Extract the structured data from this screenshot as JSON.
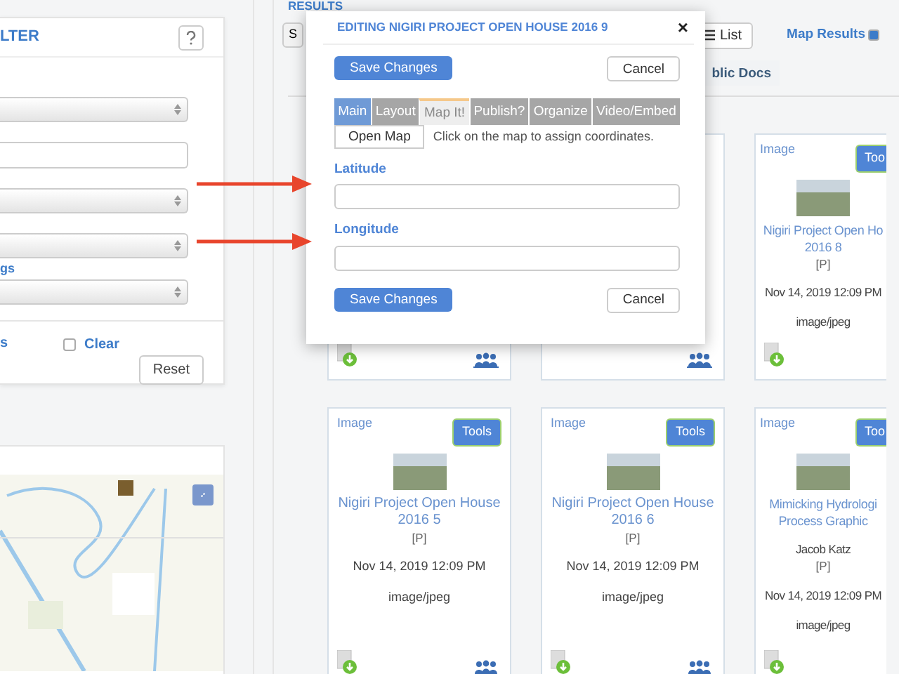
{
  "filter_panel": {
    "title": "LTER",
    "fields": [
      {
        "kind": "select"
      },
      {
        "kind": "input"
      },
      {
        "kind": "select"
      },
      {
        "kind": "select"
      },
      {
        "kind": "label",
        "text": "gs"
      },
      {
        "kind": "select"
      }
    ],
    "link": "s",
    "clear": {
      "label": "Clear",
      "checked": false
    },
    "reset_button": "Reset"
  },
  "results": {
    "heading": "RESULTS",
    "search_button": "S",
    "list_button": "List",
    "map_results": {
      "label": "Map Results",
      "checked": true
    },
    "tab": "blic Docs",
    "rows": [
      [
        {
          "kind": "covered",
          "download": true,
          "shared": true
        },
        {
          "kind": "covered",
          "download": false,
          "shared": true
        },
        {
          "kind": "full",
          "type": "Image",
          "tools": "Too",
          "title": "Nigiri Project Open Ho",
          "title_2": "2016 8",
          "tag": "[P]",
          "date": "Nov 14, 2019 12:09 PM",
          "mime": "image/jpeg",
          "download": true,
          "shared": false
        }
      ],
      [
        {
          "kind": "full",
          "type": "Image",
          "tools": "Tools",
          "title": "Nigiri Project Open House",
          "title_2": "2016 5",
          "tag": "[P]",
          "date": "Nov 14, 2019 12:09 PM",
          "mime": "image/jpeg",
          "download": true,
          "shared": true
        },
        {
          "kind": "full",
          "type": "Image",
          "tools": "Tools",
          "title": "Nigiri Project Open House",
          "title_2": "2016 6",
          "tag": "[P]",
          "date": "Nov 14, 2019 12:09 PM",
          "mime": "image/jpeg",
          "download": true,
          "shared": true
        },
        {
          "kind": "full",
          "type": "Image",
          "tools": "Too",
          "title": "Mimicking Hydrologi",
          "title_2": "Process Graphic",
          "author": "Jacob Katz",
          "tag": "[P]",
          "date": "Nov 14, 2019 12:09 PM",
          "mime": "image/jpeg",
          "download": true,
          "shared": false
        }
      ]
    ]
  },
  "modal": {
    "title": "EDITING NIGIRI PROJECT OPEN HOUSE 2016 9",
    "close": "×",
    "save_button": "Save Changes",
    "cancel_button": "Cancel",
    "tabs": [
      {
        "label": "Main",
        "selected": false
      },
      {
        "label": "Layout",
        "selected": false
      },
      {
        "label": "Map It!",
        "selected": true
      },
      {
        "label": "Publish?",
        "selected": false
      },
      {
        "label": "Organize",
        "selected": false
      },
      {
        "label": "Video/Embed",
        "selected": false
      }
    ],
    "open_map_button": "Open Map",
    "hint": "Click on the map to assign coordinates.",
    "fields": [
      {
        "label": "Latitude"
      },
      {
        "label": "Longitude"
      }
    ],
    "save_button_2": "Save Changes",
    "cancel_button_2": "Cancel"
  }
}
